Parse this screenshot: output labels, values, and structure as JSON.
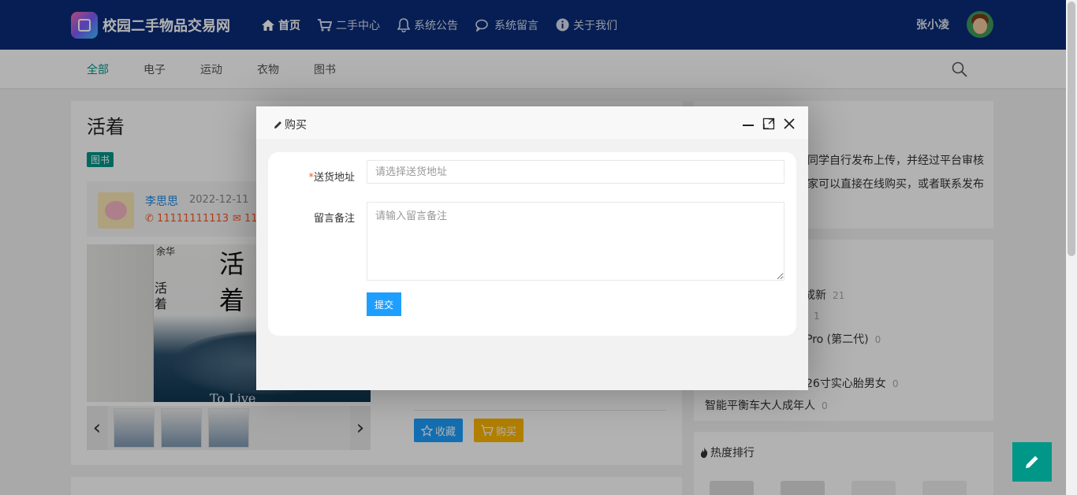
{
  "site": {
    "name": "校园二手物品交易网"
  },
  "nav": [
    {
      "label": "首页",
      "icon": "home-icon"
    },
    {
      "label": "二手中心",
      "icon": "cart-icon"
    },
    {
      "label": "系统公告",
      "icon": "bell-icon"
    },
    {
      "label": "系统留言",
      "icon": "chat-icon"
    },
    {
      "label": "关于我们",
      "icon": "info-icon"
    }
  ],
  "user": {
    "name": "张小凌"
  },
  "categories": [
    "全部",
    "电子",
    "运动",
    "衣物",
    "图书"
  ],
  "product": {
    "title": "活着",
    "tag": "图书",
    "seller_name": "李思思",
    "date": "2022-12-11",
    "phone": "11111111113",
    "email_partial": "11",
    "cover_title_1": "活",
    "cover_title_2": "着",
    "cover_author": "余华",
    "cover_spine_1": "活",
    "cover_spine_2": "着",
    "cover_en": "To Live",
    "favorite_label": "收藏",
    "buy_label": "购买"
  },
  "sidebar": {
    "intro_line1": "同学自行发布上传，并经过平台审核",
    "intro_line2": "家可以直接在线购买，或者联系发布",
    "ranking": [
      {
        "name": "成新",
        "count": "21"
      },
      {
        "name": "",
        "count": "1"
      },
      {
        "name": "Pro (第二代)",
        "count": "0"
      },
      {
        "name": "26寸实心胎男女",
        "count": "0"
      },
      {
        "name": "智能平衡车大人成年人",
        "count": "0"
      }
    ],
    "hot_title": "热度排行"
  },
  "modal": {
    "title": "购买",
    "address_label": "送货地址",
    "address_placeholder": "请选择送货地址",
    "note_label": "留言备注",
    "note_placeholder": "请输入留言备注",
    "submit_label": "提交"
  },
  "colors": {
    "topbar": "#0a2c78",
    "accent": "#009688",
    "primary": "#1e9fff",
    "warning": "#ffb800",
    "danger": "#ff5722"
  }
}
